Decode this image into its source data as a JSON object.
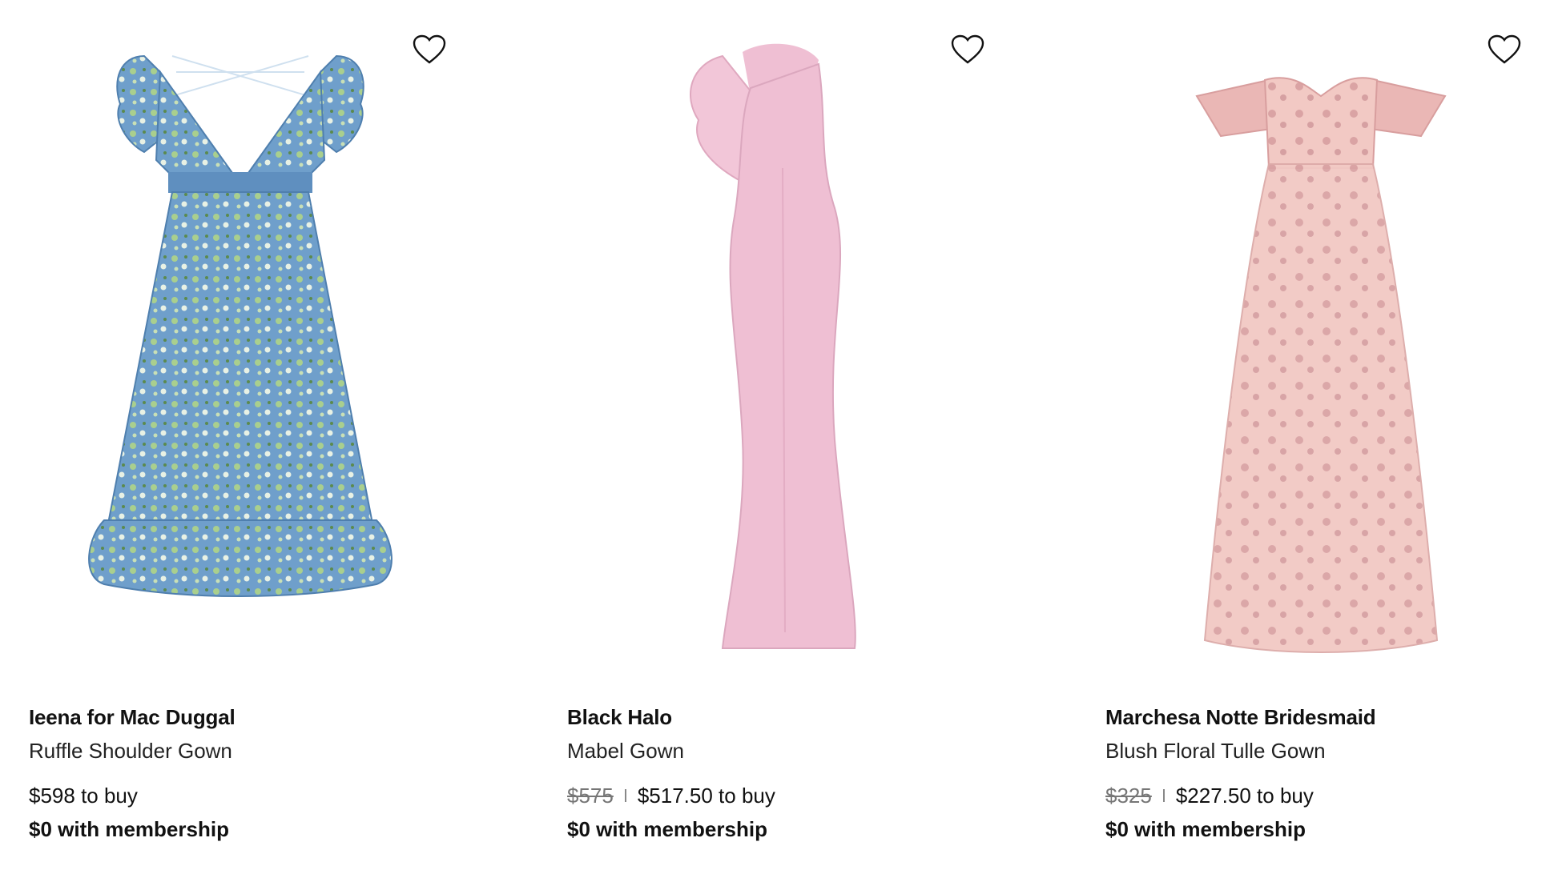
{
  "products": [
    {
      "brand": "Ieena for Mac Duggal",
      "name": "Ruffle Shoulder Gown",
      "original_price": "",
      "price": "$598 to buy",
      "membership": "$0 with membership",
      "image_icon": "blue-floral-ruffle-gown-image",
      "color": "#6f9fcb"
    },
    {
      "brand": "Black Halo",
      "name": "Mabel Gown",
      "original_price": "$575",
      "price": "$517.50 to buy",
      "membership": "$0 with membership",
      "image_icon": "pink-one-shoulder-gown-image",
      "color": "#efbfd3"
    },
    {
      "brand": "Marchesa Notte Bridesmaid",
      "name": "Blush Floral Tulle Gown",
      "original_price": "$325",
      "price": "$227.50 to buy",
      "membership": "$0 with membership",
      "image_icon": "blush-floral-tulle-gown-image",
      "color": "#efc3bf"
    }
  ]
}
